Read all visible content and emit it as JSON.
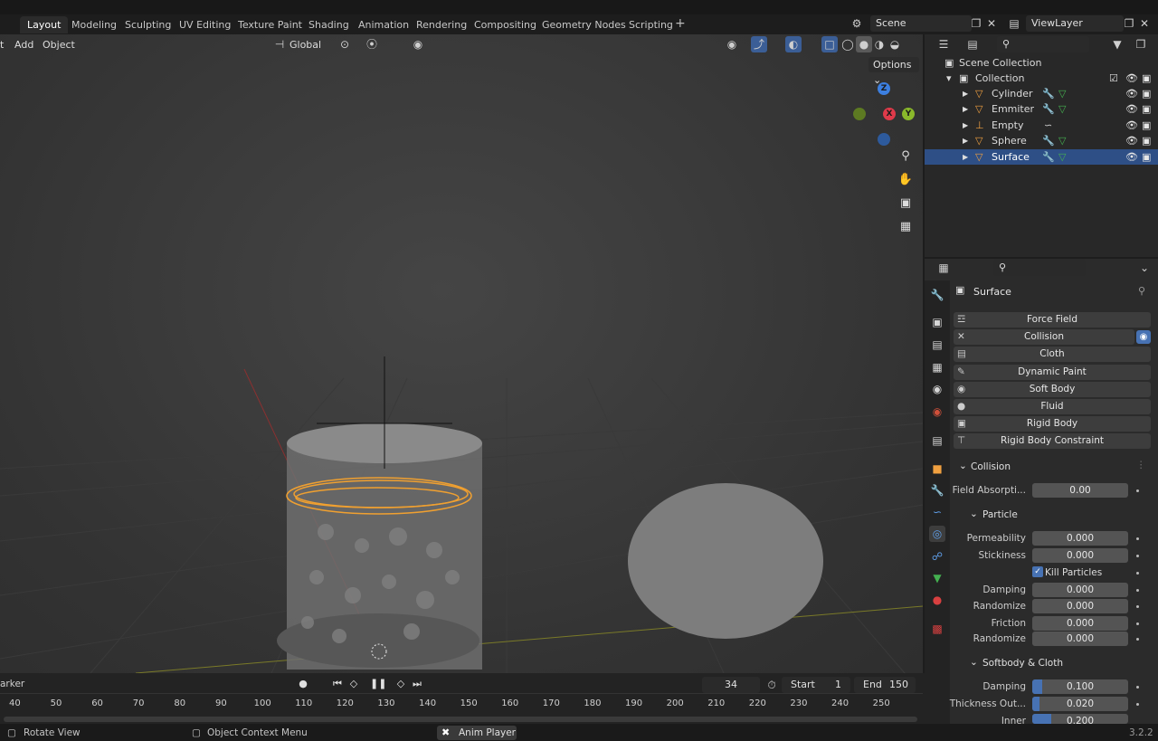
{
  "workspaces": [
    "Layout",
    "Modeling",
    "Sculpting",
    "UV Editing",
    "Texture Paint",
    "Shading",
    "Animation",
    "Rendering",
    "Compositing",
    "Geometry Nodes",
    "Scripting"
  ],
  "active_workspace": "Layout",
  "scene": "Scene",
  "view_layer": "ViewLayer",
  "viewport_menu": [
    "Add",
    "Object"
  ],
  "transform_orientation": "Global",
  "options_label": "Options",
  "gizmo": {
    "z": "Z",
    "x": "X",
    "y": "Y"
  },
  "outliner": {
    "root": "Scene Collection",
    "collection": "Collection",
    "items": [
      {
        "name": "Cylinder",
        "type": "mesh",
        "selected": false
      },
      {
        "name": "Emmiter",
        "type": "mesh",
        "selected": false
      },
      {
        "name": "Empty",
        "type": "empty",
        "selected": false
      },
      {
        "name": "Sphere",
        "type": "mesh",
        "selected": false
      },
      {
        "name": "Surface",
        "type": "mesh",
        "selected": true
      }
    ]
  },
  "properties": {
    "object_name": "Surface",
    "physics_buttons": [
      "Force Field",
      "Collision",
      "Cloth",
      "Dynamic Paint",
      "Soft Body",
      "Fluid",
      "Rigid Body",
      "Rigid Body Constraint"
    ],
    "collision_header": "Collision",
    "field_absorption_label": "Field Absorpti...",
    "field_absorption_value": "0.00",
    "particle_header": "Particle",
    "permeability_label": "Permeability",
    "permeability_value": "0.000",
    "stickiness_label": "Stickiness",
    "stickiness_value": "0.000",
    "kill_particles_label": "Kill Particles",
    "damping_label": "Damping",
    "damping_value": "0.000",
    "randomize_label": "Randomize",
    "randomize_value": "0.000",
    "friction_label": "Friction",
    "friction_value": "0.000",
    "randomize2_label": "Randomize",
    "randomize2_value": "0.000",
    "softbody_header": "Softbody & Cloth",
    "sb_damping_label": "Damping",
    "sb_damping_value": "0.100",
    "sb_damping_fraction": 0.1,
    "thickness_label": "Thickness Out...",
    "thickness_value": "0.020",
    "thickness_fraction": 0.02,
    "inner_label": "Inner",
    "inner_value": "0.200",
    "inner_fraction": 0.2
  },
  "timeline": {
    "marker_label": "arker",
    "current_frame": "34",
    "start_label": "Start",
    "start_value": "1",
    "end_label": "End",
    "end_value": "150",
    "ticks": [
      "40",
      "50",
      "60",
      "70",
      "80",
      "90",
      "100",
      "110",
      "120",
      "130",
      "140",
      "150",
      "160",
      "170",
      "180",
      "190",
      "200",
      "210",
      "220",
      "230",
      "240",
      "250"
    ]
  },
  "status": {
    "left": "Rotate View",
    "middle": "Object Context Menu",
    "anim": "Anim Player",
    "version": "3.2.2"
  }
}
